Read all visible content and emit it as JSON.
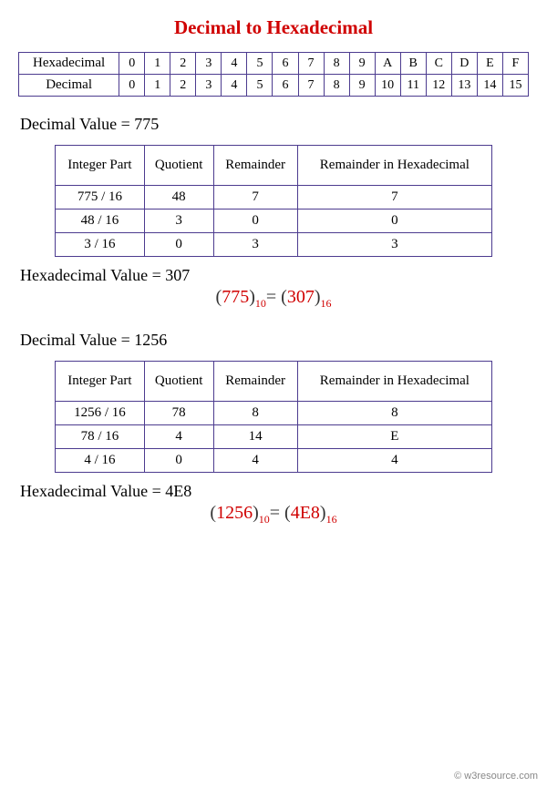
{
  "title": "Decimal to Hexadecimal",
  "mapping": {
    "hex_label": "Hexadecimal",
    "dec_label": "Decimal",
    "hex": [
      "0",
      "1",
      "2",
      "3",
      "4",
      "5",
      "6",
      "7",
      "8",
      "9",
      "A",
      "B",
      "C",
      "D",
      "E",
      "F"
    ],
    "dec": [
      "0",
      "1",
      "2",
      "3",
      "4",
      "5",
      "6",
      "7",
      "8",
      "9",
      "10",
      "11",
      "12",
      "13",
      "14",
      "15"
    ]
  },
  "example1": {
    "dec_label": "Decimal Value =  775",
    "headers": [
      "Integer Part",
      "Quotient",
      "Remainder",
      "Remainder  in Hexadecimal"
    ],
    "rows": [
      {
        "ip": "775 / 16",
        "q": "48",
        "r": "7",
        "rh": "7"
      },
      {
        "ip": "48 / 16",
        "q": "3",
        "r": "0",
        "rh": "0"
      },
      {
        "ip": "3 / 16",
        "q": "0",
        "r": "3",
        "rh": "3"
      }
    ],
    "hex_label": "Hexadecimal Value =  307",
    "eq_left": "775",
    "eq_left_base": "10",
    "eq_right": "307",
    "eq_right_base": "16"
  },
  "example2": {
    "dec_label": "Decimal Value =  1256",
    "headers": [
      "Integer Part",
      "Quotient",
      "Remainder",
      "Remainder  in Hexadecimal"
    ],
    "rows": [
      {
        "ip": "1256 / 16",
        "q": "78",
        "r": "8",
        "rh": "8"
      },
      {
        "ip": "78 / 16",
        "q": "4",
        "r": "14",
        "rh": "E"
      },
      {
        "ip": "4 / 16",
        "q": "0",
        "r": "4",
        "rh": "4"
      }
    ],
    "hex_label": "Hexadecimal Value =  4E8",
    "eq_left": "1256",
    "eq_left_base": "10",
    "eq_right": "4E8",
    "eq_right_base": "16"
  },
  "footer": "© w3resource.com"
}
